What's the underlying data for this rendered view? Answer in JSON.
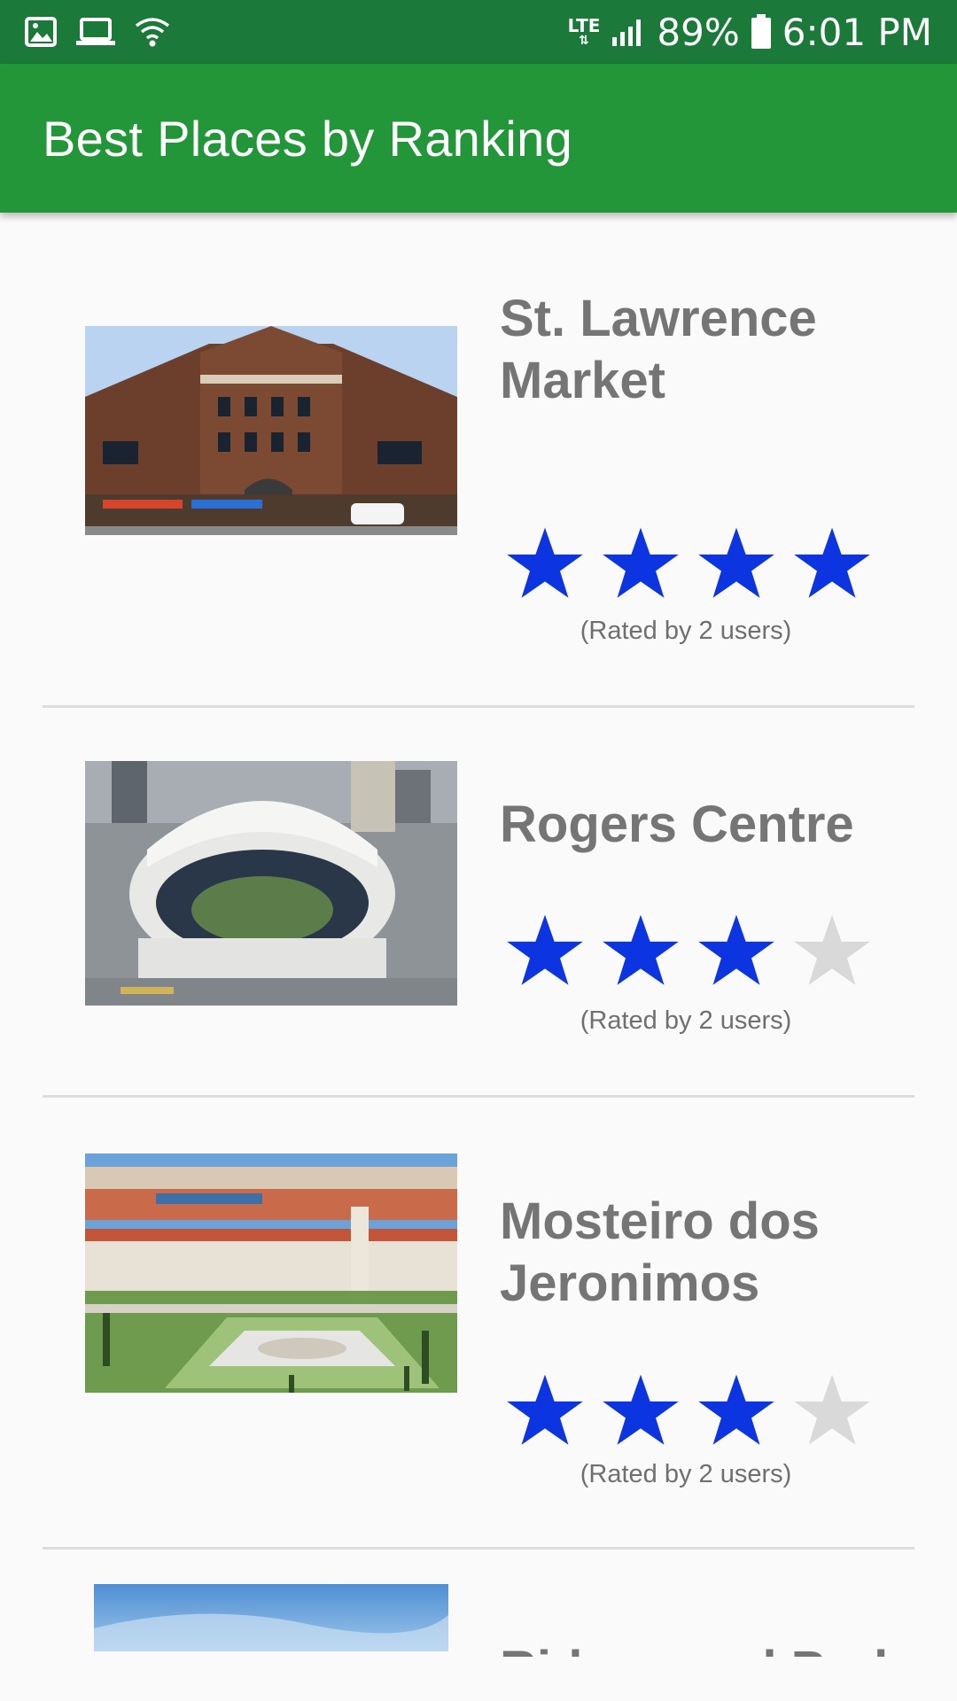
{
  "status_bar": {
    "icons": [
      "image-icon",
      "laptop-icon",
      "wifi-icon",
      "signal-icon",
      "battery-icon"
    ],
    "network": "LTE",
    "battery": "89%",
    "time": "6:01 PM"
  },
  "app_bar": {
    "title": "Best Places by Ranking"
  },
  "colors": {
    "status_bar": "#1b7a3a",
    "app_bar": "#24963a",
    "star_filled": "#0c34e0",
    "star_empty": "#d9d9d9",
    "name_text": "#757575"
  },
  "places": [
    {
      "name": "St. Lawrence Market",
      "rating": 4,
      "max_rating": 4,
      "rated_text": "(Rated by 2 users)"
    },
    {
      "name": "Rogers Centre",
      "rating": 3,
      "max_rating": 4,
      "rated_text": "(Rated by 2 users)"
    },
    {
      "name": "Mosteiro dos Jeronimos",
      "rating": 3,
      "max_rating": 4,
      "rated_text": "(Rated by 2 users)"
    },
    {
      "name": "Ridgewood Park",
      "rating": 0,
      "max_rating": 4,
      "rated_text": ""
    }
  ]
}
